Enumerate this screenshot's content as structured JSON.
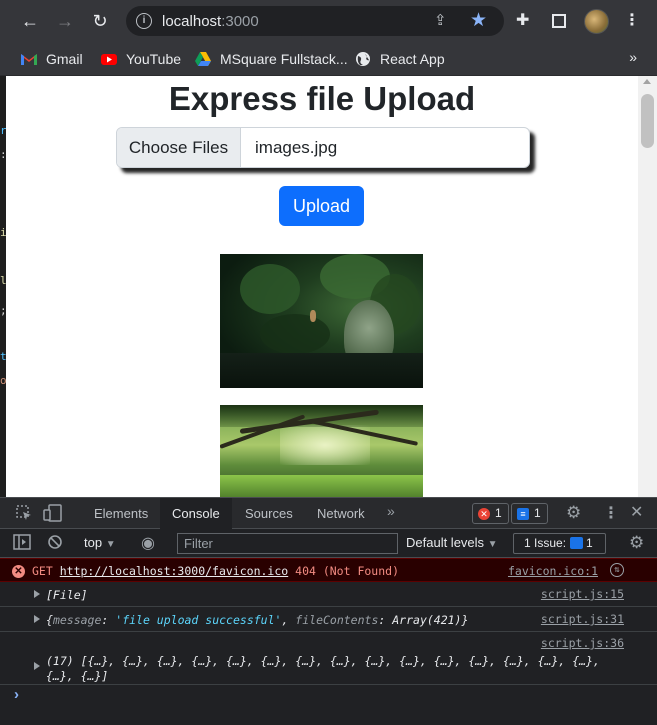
{
  "browser": {
    "url_host": "localhost",
    "url_port": ":3000",
    "bookmarks": [
      {
        "label": "Gmail",
        "icon": "gmail-icon"
      },
      {
        "label": "YouTube",
        "icon": "youtube-icon"
      },
      {
        "label": "MSquare Fullstack...",
        "icon": "drive-icon"
      },
      {
        "label": "React App",
        "icon": "globe-icon"
      }
    ],
    "more": "»"
  },
  "page": {
    "title": "Express file Upload",
    "choose_label": "Choose Files",
    "file_name": "images.jpg",
    "upload_label": "Upload"
  },
  "devtools": {
    "tabs": [
      "Elements",
      "Console",
      "Sources",
      "Network"
    ],
    "active_tab": "Console",
    "more_tabs": "»",
    "error_count": "1",
    "message_count": "1",
    "context": "top",
    "filter_placeholder": "Filter",
    "levels": "Default levels",
    "issues_label": "1 Issue:",
    "issues_count": "1",
    "logs": {
      "error": {
        "method": "GET",
        "url": "http://localhost:3000/favicon.ico",
        "status": "404 (Not Found)",
        "source": "favicon.ico:1"
      },
      "file": {
        "text": "[File]",
        "source": "script.js:15"
      },
      "message": {
        "open": "{",
        "key1": "message",
        "value1": "'file upload successful'",
        "key2": "fileContents",
        "value2": "Array(421)",
        "close": "}",
        "source": "script.js:31"
      },
      "array": {
        "line1": "(17) [{…}, {…}, {…}, {…}, {…}, {…}, {…}, {…}, {…}, {…}, {…}, {…}, {…}, {…}, {…},",
        "line2": "{…}, {…}]",
        "source": "script.js:36"
      }
    },
    "prompt": "›"
  }
}
